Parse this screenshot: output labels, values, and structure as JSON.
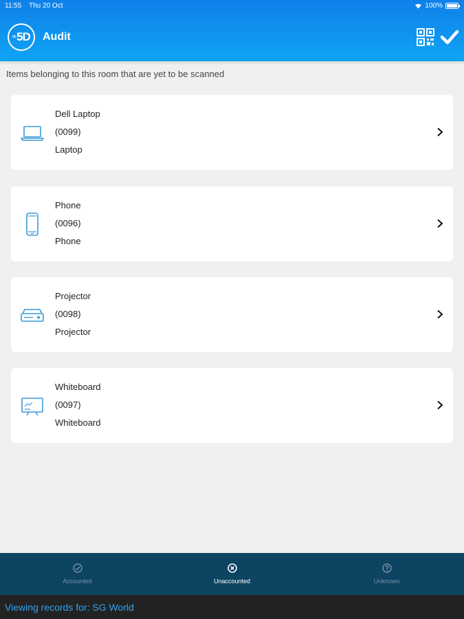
{
  "status": {
    "time": "11:55",
    "date": "Thu 20 Oct",
    "battery": "100%",
    "battery_level": 1.0
  },
  "header": {
    "logo_text": "5D",
    "logo_small": "IS",
    "title": "Audit"
  },
  "subtitle": "Items belonging to this room that are yet to be scanned",
  "items": [
    {
      "name": "Dell Laptop",
      "code": "(0099)",
      "type": "Laptop",
      "icon": "laptop-icon"
    },
    {
      "name": "Phone",
      "code": "(0096)",
      "type": "Phone",
      "icon": "phone-icon"
    },
    {
      "name": "Projector",
      "code": "(0098)",
      "type": "Projector",
      "icon": "projector-icon"
    },
    {
      "name": "Whiteboard",
      "code": "(0097)",
      "type": "Whiteboard",
      "icon": "whiteboard-icon"
    }
  ],
  "tabs": [
    {
      "label": "Accounted",
      "icon": "check-circle-icon",
      "active": false
    },
    {
      "label": "Unaccounted",
      "icon": "x-circle-icon",
      "active": true
    },
    {
      "label": "Unknown",
      "icon": "question-circle-icon",
      "active": false
    }
  ],
  "footer": {
    "text": "Viewing records for: SG World"
  },
  "colors": {
    "header": "#0f80e9",
    "accent": "#2fa4ef",
    "tabbar": "#0c4461",
    "icon": "#3a9ad9"
  }
}
